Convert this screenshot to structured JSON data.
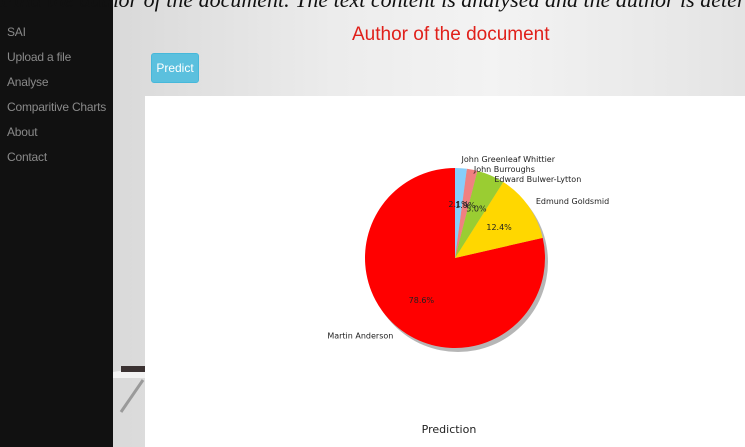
{
  "top_text": "Find the author of the document. The text content is analysed and the author is determined",
  "sidebar": {
    "items": [
      {
        "label": "SAI"
      },
      {
        "label": "Upload a file"
      },
      {
        "label": "Analyse"
      },
      {
        "label": "Comparitive Charts"
      },
      {
        "label": "About"
      },
      {
        "label": "Contact"
      }
    ]
  },
  "main": {
    "title": "Author of the document",
    "predict_label": "Predict"
  },
  "colors": {
    "sidebar_bg": "#111111",
    "title": "#e0201a",
    "button": "#5bc0de"
  },
  "chart_data": {
    "type": "pie",
    "title": "",
    "xlabel": "Prediction",
    "slices": [
      {
        "label": "Martin Anderson",
        "value": 78.6,
        "pct_label": "78.6%",
        "color": "#ff0000"
      },
      {
        "label": "Edmund Goldsmid",
        "value": 12.4,
        "pct_label": "12.4%",
        "color": "#ffd700"
      },
      {
        "label": "Edward Bulwer-Lytton",
        "value": 5.0,
        "pct_label": "5.0%",
        "color": "#9acd32"
      },
      {
        "label": "John Burroughs",
        "value": 1.9,
        "pct_label": "1.9%",
        "color": "#f08080"
      },
      {
        "label": "John Greenleaf Whittier",
        "value": 2.1,
        "pct_label": "2.1%",
        "color": "#87cefa"
      }
    ],
    "shadow": true,
    "start_angle_deg": 90
  }
}
